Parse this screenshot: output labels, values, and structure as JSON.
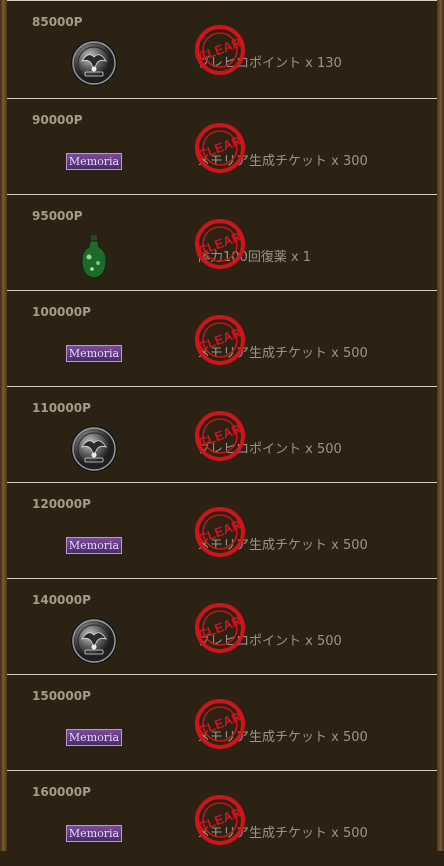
{
  "rewards": [
    {
      "points": "85000P",
      "icon": "crest-coin-icon",
      "reward": "ブレヒロポイント x 130",
      "stamp": "CLEAR"
    },
    {
      "points": "90000P",
      "icon": "memoria-ticket-icon",
      "icon_text": "Memoria",
      "reward": "メモリア生成チケット x 300",
      "stamp": "CLEAR"
    },
    {
      "points": "95000P",
      "icon": "green-potion-icon",
      "reward": "体力100回復薬 x 1",
      "stamp": "CLEAR"
    },
    {
      "points": "100000P",
      "icon": "memoria-ticket-icon",
      "icon_text": "Memoria",
      "reward": "メモリア生成チケット x 500",
      "stamp": "CLEAR"
    },
    {
      "points": "110000P",
      "icon": "crest-coin-icon",
      "reward": "ブレヒロポイント x 500",
      "stamp": "CLEAR"
    },
    {
      "points": "120000P",
      "icon": "memoria-ticket-icon",
      "icon_text": "Memoria",
      "reward": "メモリア生成チケット x 500",
      "stamp": "CLEAR"
    },
    {
      "points": "140000P",
      "icon": "crest-coin-icon",
      "reward": "ブレヒロポイント x 500",
      "stamp": "CLEAR"
    },
    {
      "points": "150000P",
      "icon": "memoria-ticket-icon",
      "icon_text": "Memoria",
      "reward": "メモリア生成チケット x 500",
      "stamp": "CLEAR"
    },
    {
      "points": "160000P",
      "icon": "memoria-ticket-icon",
      "icon_text": "Memoria",
      "reward": "メモリア生成チケット x 500",
      "stamp": "CLEAR"
    }
  ],
  "colors": {
    "stamp": "#d0141a",
    "background": "#2c2214",
    "points_text": "#a89c88"
  }
}
